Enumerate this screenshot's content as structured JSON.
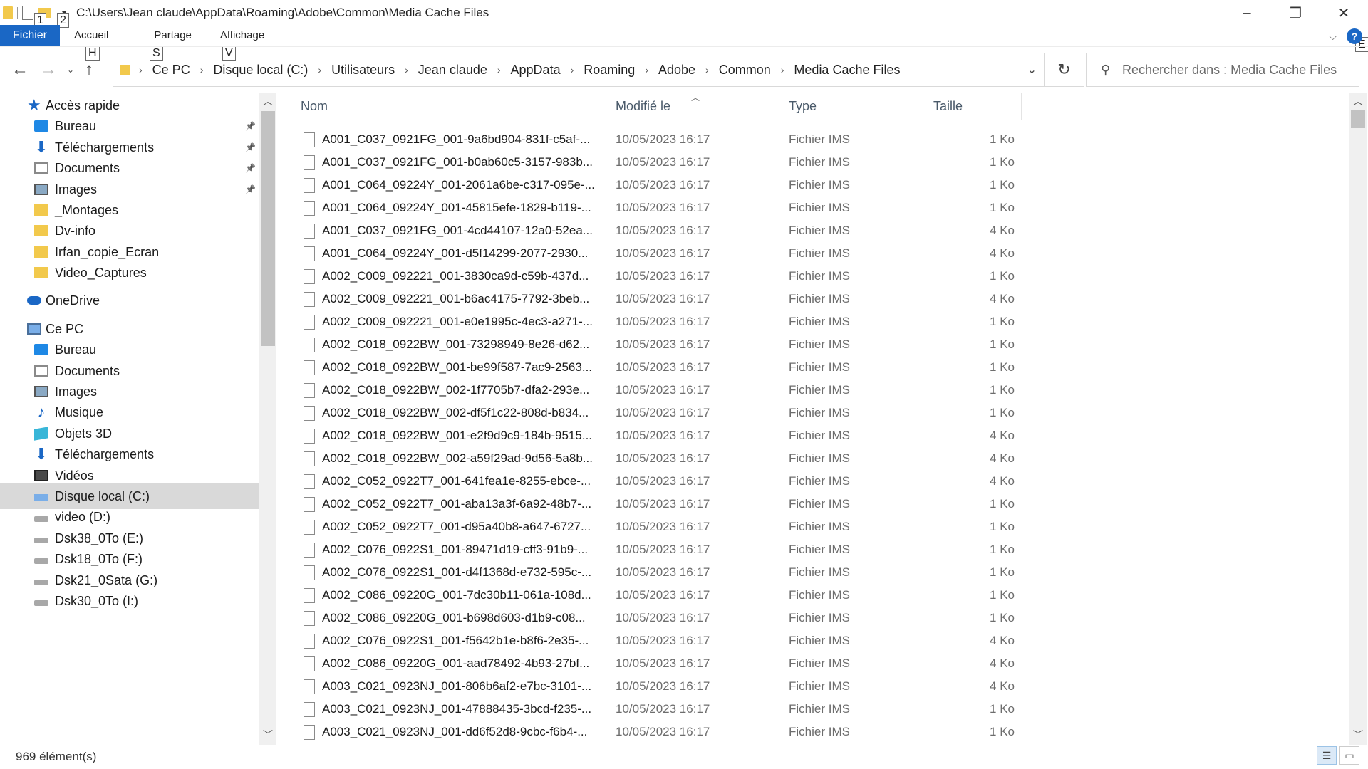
{
  "window": {
    "title": "C:\\Users\\Jean claude\\AppData\\Roaming\\Adobe\\Common\\Media Cache Files",
    "keytips": [
      "1",
      "2",
      "H",
      "S",
      "V",
      "E"
    ]
  },
  "ribbon": {
    "file_tab": "Fichier",
    "tabs": [
      "Accueil",
      "Partage",
      "Affichage"
    ]
  },
  "address": {
    "breadcrumbs": [
      "Ce PC",
      "Disque local (C:)",
      "Utilisateurs",
      "Jean claude",
      "AppData",
      "Roaming",
      "Adobe",
      "Common",
      "Media Cache Files"
    ]
  },
  "search": {
    "placeholder": "Rechercher dans : Media Cache Files"
  },
  "navpane": {
    "items": [
      {
        "label": "Accès rapide",
        "icon": "star-icon",
        "level": 0,
        "pinned": false,
        "selected": false
      },
      {
        "label": "Bureau",
        "icon": "desktop-icon",
        "level": 1,
        "pinned": true,
        "selected": false
      },
      {
        "label": "Téléchargements",
        "icon": "download-icon",
        "level": 1,
        "pinned": true,
        "selected": false
      },
      {
        "label": "Documents",
        "icon": "documents-icon",
        "level": 1,
        "pinned": true,
        "selected": false
      },
      {
        "label": "Images",
        "icon": "images-icon",
        "level": 1,
        "pinned": true,
        "selected": false
      },
      {
        "label": "_Montages",
        "icon": "folder-icon",
        "level": 1,
        "pinned": false,
        "selected": false
      },
      {
        "label": "Dv-info",
        "icon": "folder-icon",
        "level": 1,
        "pinned": false,
        "selected": false
      },
      {
        "label": "Irfan_copie_Ecran",
        "icon": "folder-icon",
        "level": 1,
        "pinned": false,
        "selected": false
      },
      {
        "label": "Video_Captures",
        "icon": "folder-icon",
        "level": 1,
        "pinned": false,
        "selected": false
      },
      {
        "label": "OneDrive",
        "icon": "cloud-icon",
        "level": 0,
        "pinned": false,
        "selected": false
      },
      {
        "label": "Ce PC",
        "icon": "computer-icon",
        "level": 0,
        "pinned": false,
        "selected": false
      },
      {
        "label": "Bureau",
        "icon": "desktop-icon",
        "level": 1,
        "pinned": false,
        "selected": false
      },
      {
        "label": "Documents",
        "icon": "documents-icon",
        "level": 1,
        "pinned": false,
        "selected": false
      },
      {
        "label": "Images",
        "icon": "images-icon",
        "level": 1,
        "pinned": false,
        "selected": false
      },
      {
        "label": "Musique",
        "icon": "music-icon",
        "level": 1,
        "pinned": false,
        "selected": false
      },
      {
        "label": "Objets 3D",
        "icon": "3d-objects-icon",
        "level": 1,
        "pinned": false,
        "selected": false
      },
      {
        "label": "Téléchargements",
        "icon": "download-icon",
        "level": 1,
        "pinned": false,
        "selected": false
      },
      {
        "label": "Vidéos",
        "icon": "videos-icon",
        "level": 1,
        "pinned": false,
        "selected": false
      },
      {
        "label": "Disque local (C:)",
        "icon": "system-drive-icon",
        "level": 1,
        "pinned": false,
        "selected": true
      },
      {
        "label": "video (D:)",
        "icon": "drive-icon",
        "level": 1,
        "pinned": false,
        "selected": false
      },
      {
        "label": "Dsk38_0To (E:)",
        "icon": "drive-icon",
        "level": 1,
        "pinned": false,
        "selected": false
      },
      {
        "label": "Dsk18_0To (F:)",
        "icon": "drive-icon",
        "level": 1,
        "pinned": false,
        "selected": false
      },
      {
        "label": "Dsk21_0Sata (G:)",
        "icon": "drive-icon",
        "level": 1,
        "pinned": false,
        "selected": false
      },
      {
        "label": "Dsk30_0To (I:)",
        "icon": "drive-icon",
        "level": 1,
        "pinned": false,
        "selected": false
      }
    ]
  },
  "filelist": {
    "columns": [
      "Nom",
      "Modifié le",
      "Type",
      "Taille"
    ],
    "rows": [
      {
        "name": "A001_C037_0921FG_001-9a6bd904-831f-c5af-...",
        "date": "10/05/2023 16:17",
        "type": "Fichier IMS",
        "size": "1 Ko"
      },
      {
        "name": "A001_C037_0921FG_001-b0ab60c5-3157-983b...",
        "date": "10/05/2023 16:17",
        "type": "Fichier IMS",
        "size": "1 Ko"
      },
      {
        "name": "A001_C064_09224Y_001-2061a6be-c317-095e-...",
        "date": "10/05/2023 16:17",
        "type": "Fichier IMS",
        "size": "1 Ko"
      },
      {
        "name": "A001_C064_09224Y_001-45815efe-1829-b119-...",
        "date": "10/05/2023 16:17",
        "type": "Fichier IMS",
        "size": "1 Ko"
      },
      {
        "name": "A001_C037_0921FG_001-4cd44107-12a0-52ea...",
        "date": "10/05/2023 16:17",
        "type": "Fichier IMS",
        "size": "4 Ko"
      },
      {
        "name": "A001_C064_09224Y_001-d5f14299-2077-2930...",
        "date": "10/05/2023 16:17",
        "type": "Fichier IMS",
        "size": "4 Ko"
      },
      {
        "name": "A002_C009_092221_001-3830ca9d-c59b-437d...",
        "date": "10/05/2023 16:17",
        "type": "Fichier IMS",
        "size": "1 Ko"
      },
      {
        "name": "A002_C009_092221_001-b6ac4175-7792-3beb...",
        "date": "10/05/2023 16:17",
        "type": "Fichier IMS",
        "size": "4 Ko"
      },
      {
        "name": "A002_C009_092221_001-e0e1995c-4ec3-a271-...",
        "date": "10/05/2023 16:17",
        "type": "Fichier IMS",
        "size": "1 Ko"
      },
      {
        "name": "A002_C018_0922BW_001-73298949-8e26-d62...",
        "date": "10/05/2023 16:17",
        "type": "Fichier IMS",
        "size": "1 Ko"
      },
      {
        "name": "A002_C018_0922BW_001-be99f587-7ac9-2563...",
        "date": "10/05/2023 16:17",
        "type": "Fichier IMS",
        "size": "1 Ko"
      },
      {
        "name": "A002_C018_0922BW_002-1f7705b7-dfa2-293e...",
        "date": "10/05/2023 16:17",
        "type": "Fichier IMS",
        "size": "1 Ko"
      },
      {
        "name": "A002_C018_0922BW_002-df5f1c22-808d-b834...",
        "date": "10/05/2023 16:17",
        "type": "Fichier IMS",
        "size": "1 Ko"
      },
      {
        "name": "A002_C018_0922BW_001-e2f9d9c9-184b-9515...",
        "date": "10/05/2023 16:17",
        "type": "Fichier IMS",
        "size": "4 Ko"
      },
      {
        "name": "A002_C018_0922BW_002-a59f29ad-9d56-5a8b...",
        "date": "10/05/2023 16:17",
        "type": "Fichier IMS",
        "size": "4 Ko"
      },
      {
        "name": "A002_C052_0922T7_001-641fea1e-8255-ebce-...",
        "date": "10/05/2023 16:17",
        "type": "Fichier IMS",
        "size": "4 Ko"
      },
      {
        "name": "A002_C052_0922T7_001-aba13a3f-6a92-48b7-...",
        "date": "10/05/2023 16:17",
        "type": "Fichier IMS",
        "size": "1 Ko"
      },
      {
        "name": "A002_C052_0922T7_001-d95a40b8-a647-6727...",
        "date": "10/05/2023 16:17",
        "type": "Fichier IMS",
        "size": "1 Ko"
      },
      {
        "name": "A002_C076_0922S1_001-89471d19-cff3-91b9-...",
        "date": "10/05/2023 16:17",
        "type": "Fichier IMS",
        "size": "1 Ko"
      },
      {
        "name": "A002_C076_0922S1_001-d4f1368d-e732-595c-...",
        "date": "10/05/2023 16:17",
        "type": "Fichier IMS",
        "size": "1 Ko"
      },
      {
        "name": "A002_C086_09220G_001-7dc30b11-061a-108d...",
        "date": "10/05/2023 16:17",
        "type": "Fichier IMS",
        "size": "1 Ko"
      },
      {
        "name": "A002_C086_09220G_001-b698d603-d1b9-c08...",
        "date": "10/05/2023 16:17",
        "type": "Fichier IMS",
        "size": "1 Ko"
      },
      {
        "name": "A002_C076_0922S1_001-f5642b1e-b8f6-2e35-...",
        "date": "10/05/2023 16:17",
        "type": "Fichier IMS",
        "size": "4 Ko"
      },
      {
        "name": "A002_C086_09220G_001-aad78492-4b93-27bf...",
        "date": "10/05/2023 16:17",
        "type": "Fichier IMS",
        "size": "4 Ko"
      },
      {
        "name": "A003_C021_0923NJ_001-806b6af2-e7bc-3101-...",
        "date": "10/05/2023 16:17",
        "type": "Fichier IMS",
        "size": "4 Ko"
      },
      {
        "name": "A003_C021_0923NJ_001-47888435-3bcd-f235-...",
        "date": "10/05/2023 16:17",
        "type": "Fichier IMS",
        "size": "1 Ko"
      },
      {
        "name": "A003_C021_0923NJ_001-dd6f52d8-9cbc-f6b4-...",
        "date": "10/05/2023 16:17",
        "type": "Fichier IMS",
        "size": "1 Ko"
      }
    ]
  },
  "status": {
    "count": "969 élément(s)"
  },
  "colors": {
    "accent": "#1a67c5",
    "folder": "#f2c94c",
    "selected_bg": "#d9d9d9"
  }
}
